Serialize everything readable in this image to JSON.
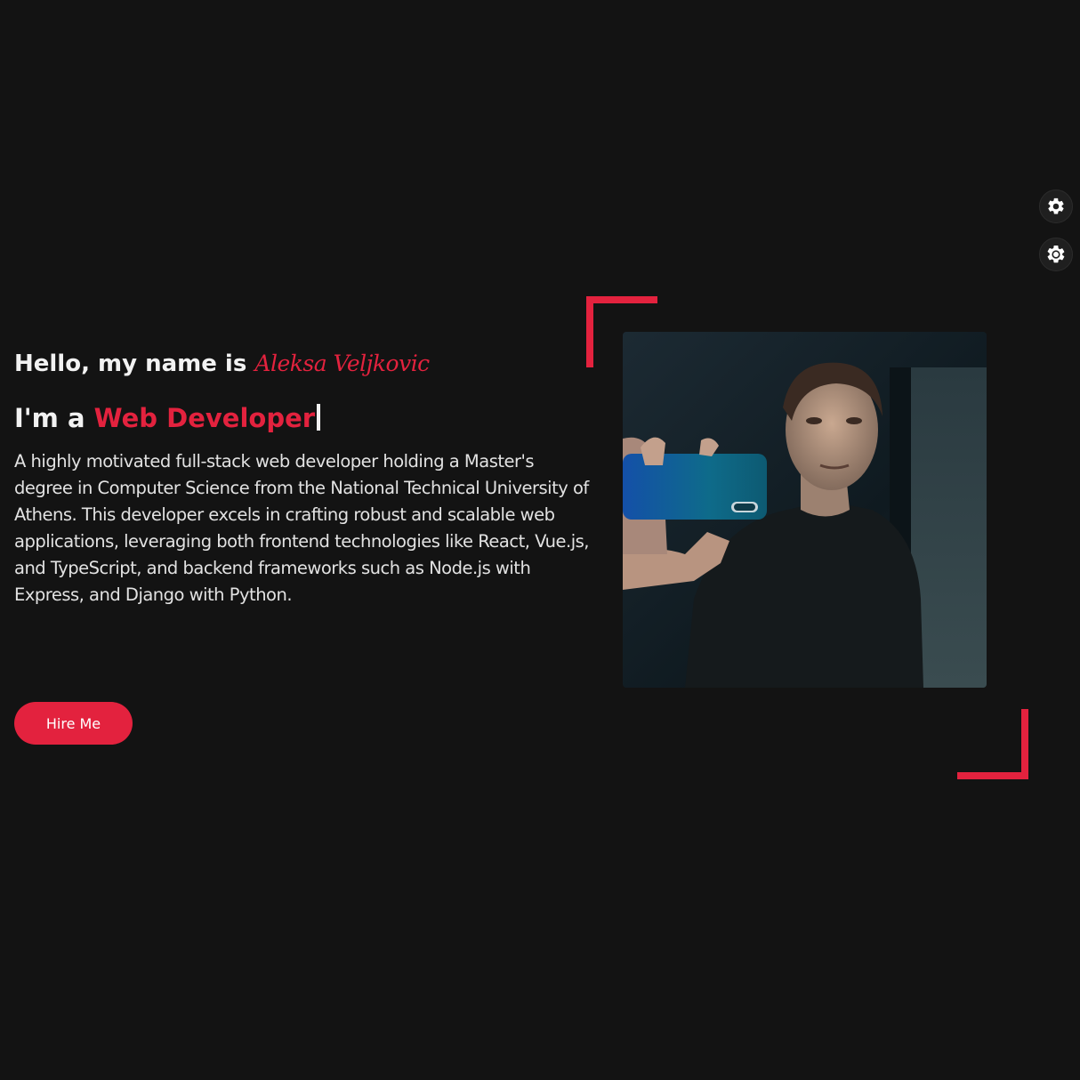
{
  "settings": {
    "gear_icon": "gear-icon",
    "theme_icon": "sun-gear-icon"
  },
  "hero": {
    "greeting": "Hello, my name is",
    "name": "Aleksa Veljkovic",
    "role_prefix": "I'm a",
    "role_highlight": "Web Developer",
    "bio": "A highly motivated full-stack web developer holding a Master's degree in Computer Science from the National Technical University of Athens. This developer excels in crafting robust and scalable web applications, leveraging both frontend technologies like React, Vue.js, and TypeScript, and backend frameworks such as Node.js with Express, and Django with Python.",
    "hire_button": "Hire Me"
  },
  "colors": {
    "background": "#131313",
    "accent": "#e3223e",
    "text": "#f2f2f2"
  }
}
